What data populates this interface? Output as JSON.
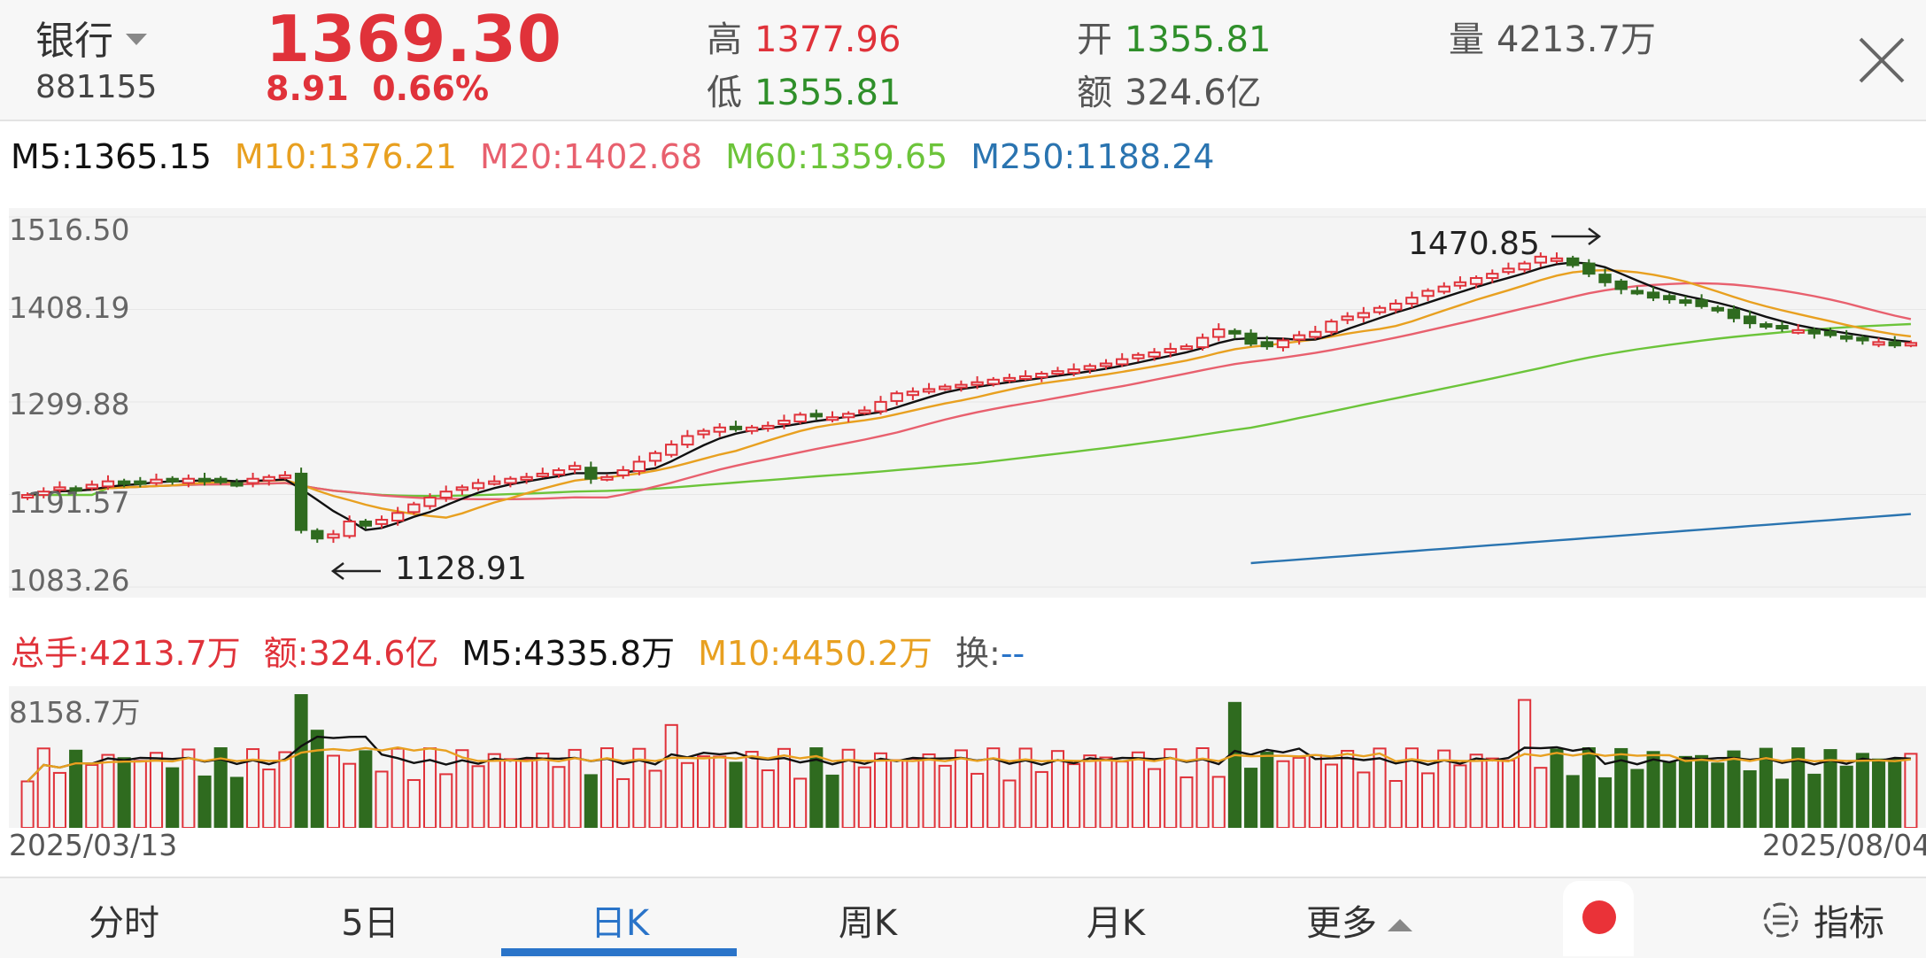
{
  "header": {
    "name": "银行",
    "code": "881155",
    "price": "1369.30",
    "change": "8.91",
    "change_pct": "0.66%",
    "high_label": "高",
    "high": "1377.96",
    "low_label": "低",
    "low": "1355.81",
    "open_label": "开",
    "open": "1355.81",
    "amount_label": "额",
    "amount": "324.6亿",
    "volume_label": "量",
    "volume": "4213.7万"
  },
  "ma_legend": {
    "m5": "M5:1365.15",
    "m10": "M10:1376.21",
    "m20": "M20:1402.68",
    "m60": "M60:1359.65",
    "m250": "M250:1188.24"
  },
  "price_axis": [
    "1516.50",
    "1408.19",
    "1299.88",
    "1191.57",
    "1083.26"
  ],
  "annotations": {
    "high": "1470.85",
    "low": "1128.91"
  },
  "volume_legend": {
    "total": "总手:4213.7万",
    "amount": "额:324.6亿",
    "m5": "M5:4335.8万",
    "m10": "M10:4450.2万",
    "turnover_label": "换:",
    "turnover_value": "--"
  },
  "volume_axis": {
    "max": "8158.7万"
  },
  "dates": {
    "start": "2025/03/13",
    "end": "2025/08/04"
  },
  "tabs": [
    "分时",
    "5日",
    "日K",
    "周K",
    "月K",
    "更多"
  ],
  "active_tab": "日K",
  "indicator_label": "指标",
  "colors": {
    "up": "#e0323a",
    "down": "#2f6b1f",
    "m5": "#111111",
    "m10": "#e8a020",
    "m20": "#e8606e",
    "m60": "#6cc43a",
    "m250": "#2a74b0",
    "active": "#2a74c9"
  },
  "chart_data": {
    "type": "candlestick",
    "x_start": "2025/03/13",
    "x_end": "2025/08/04",
    "ylim": [
      1083.26,
      1516.5
    ],
    "close_series_approx": [
      1191,
      1195,
      1200,
      1198,
      1203,
      1207,
      1205,
      1206,
      1209,
      1207,
      1210,
      1208,
      1206,
      1204,
      1210,
      1212,
      1214,
      1150,
      1140,
      1145,
      1160,
      1155,
      1162,
      1170,
      1180,
      1188,
      1195,
      1200,
      1205,
      1207,
      1210,
      1212,
      1216,
      1220,
      1225,
      1210,
      1212,
      1220,
      1230,
      1240,
      1250,
      1260,
      1266,
      1270,
      1268,
      1270,
      1272,
      1278,
      1285,
      1283,
      1282,
      1286,
      1290,
      1300,
      1310,
      1312,
      1315,
      1318,
      1320,
      1323,
      1326,
      1328,
      1330,
      1333,
      1336,
      1338,
      1342,
      1345,
      1350,
      1355,
      1358,
      1362,
      1365,
      1375,
      1385,
      1380,
      1368,
      1365,
      1372,
      1378,
      1382,
      1394,
      1400,
      1404,
      1410,
      1415,
      1422,
      1430,
      1435,
      1440,
      1445,
      1450,
      1456,
      1462,
      1470,
      1468,
      1460,
      1450,
      1440,
      1432,
      1428,
      1422,
      1420,
      1418,
      1412,
      1408,
      1398,
      1392,
      1388,
      1386,
      1384,
      1380,
      1378,
      1374,
      1372,
      1370,
      1366,
      1369
    ],
    "volume_max": "8158.7万"
  }
}
